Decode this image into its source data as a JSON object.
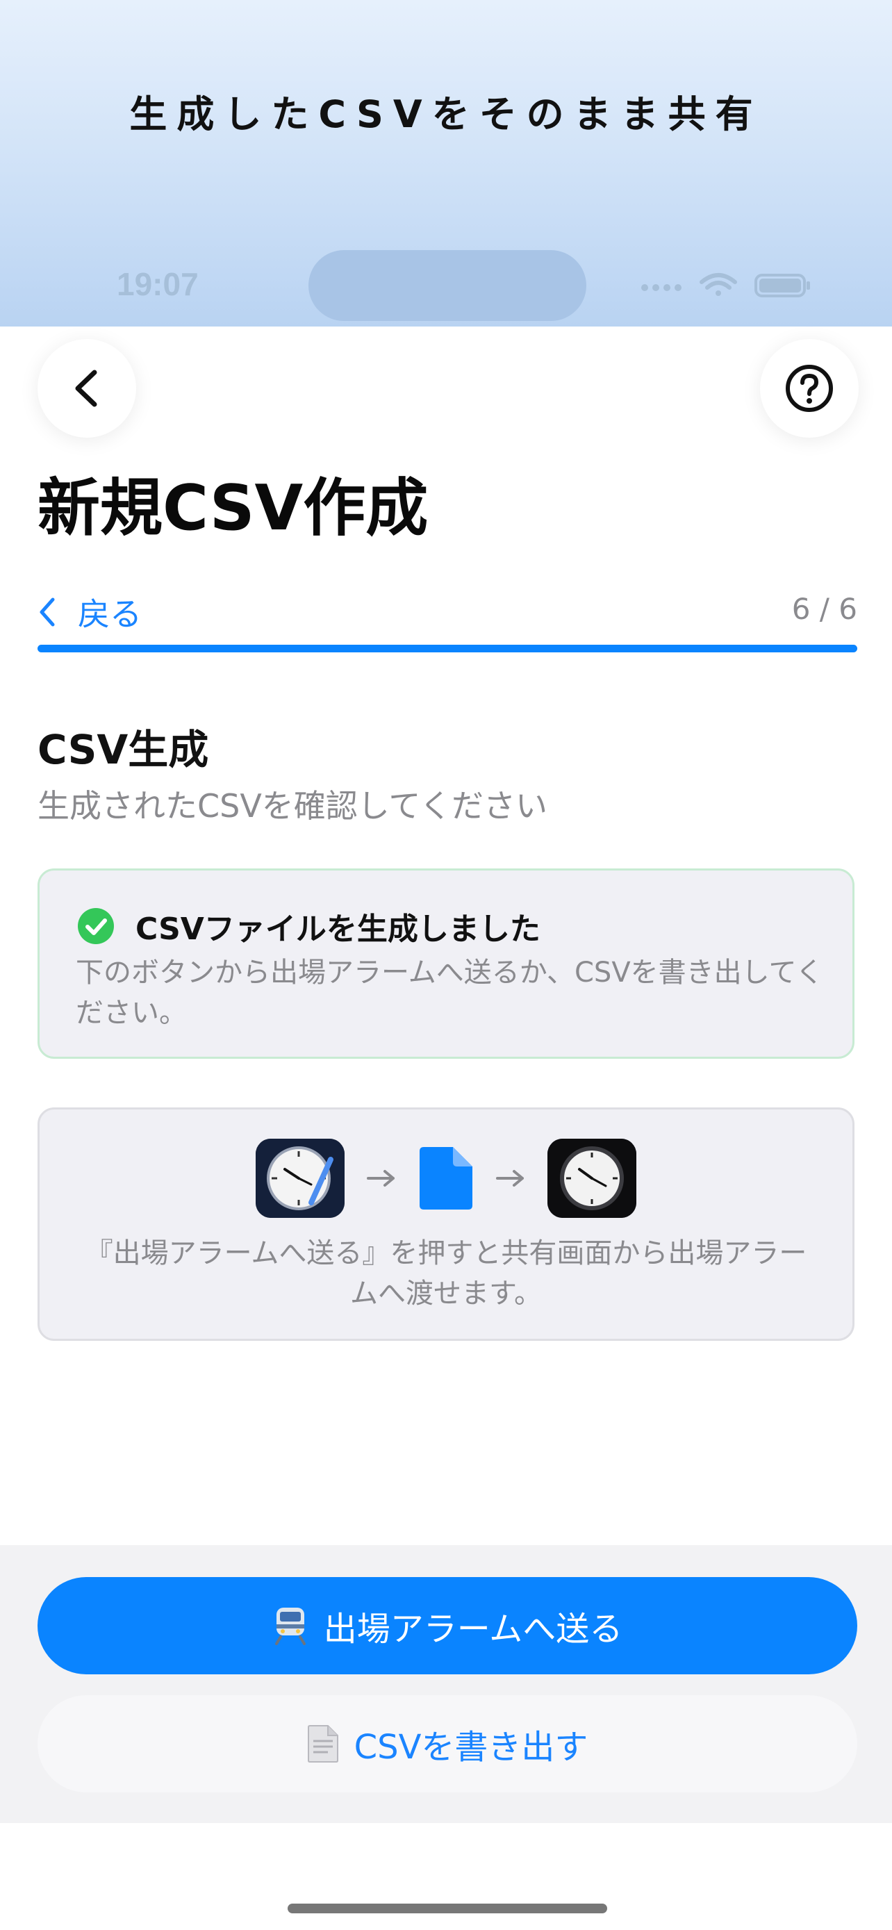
{
  "banner": {
    "title": "生成したCSVをそのまま共有"
  },
  "status_bar": {
    "time": "19:07"
  },
  "header": {
    "title": "新規CSV作成",
    "back_icon": "chevron-left-icon",
    "help_icon": "question-circle-icon"
  },
  "steps": {
    "back_label": "戻る",
    "counter": "6 / 6",
    "progress": 1.0
  },
  "section": {
    "title": "CSV生成",
    "subtitle": "生成されたCSVを確認してください"
  },
  "success_card": {
    "icon": "check-circle-icon",
    "title": "CSVファイルを生成しました",
    "description": "下のボタンから出場アラームへ送るか、CSVを書き出してください。"
  },
  "flow_card": {
    "icons": [
      "app-creator-clock-icon",
      "document-icon",
      "alarm-clock-app-icon"
    ],
    "note": "『出場アラームへ送る』を押すと共有画面から出場アラームへ渡せます。"
  },
  "actions": {
    "primary_icon": "train-emoji-icon",
    "primary_label": "出場アラームへ送る",
    "secondary_icon": "document-emoji-icon",
    "secondary_label": "CSVを書き出す"
  },
  "colors": {
    "accent": "#0a84ff",
    "success": "#34c759",
    "banner_top": "#e6f0fc",
    "banner_bottom": "#b9d3f2"
  }
}
